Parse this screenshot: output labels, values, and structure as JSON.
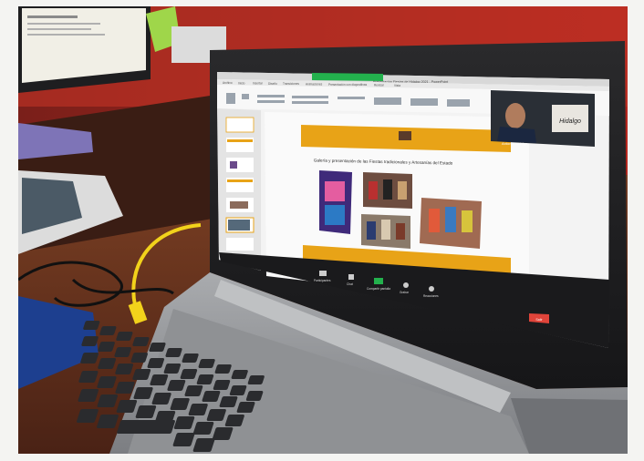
{
  "screen": {
    "window_title": "Presentación Fiestas de Hidalgo 2021 - PowerPoint",
    "ribbon_tabs": [
      "Archivo",
      "Inicio",
      "Insertar",
      "Diseño",
      "Transiciones",
      "Animaciones",
      "Presentación con diapositivas",
      "Revisar",
      "Vista"
    ],
    "slide_heading": "Galería y presentación de las Fiestas tradicionales y Artesanías del Estado",
    "participant_name": "Antonio Hidalgo",
    "participant_badge": "Hidalgo",
    "zoom_controls": [
      "Participantes",
      "Chat",
      "Compartir pantalla",
      "Grabar",
      "Reacciones"
    ],
    "end_button": "Salir"
  },
  "colors": {
    "slide_band": "#e8a317",
    "zoom_green": "#23b14d",
    "end_red": "#e0443a",
    "cable_yellow": "#f2d21b"
  }
}
